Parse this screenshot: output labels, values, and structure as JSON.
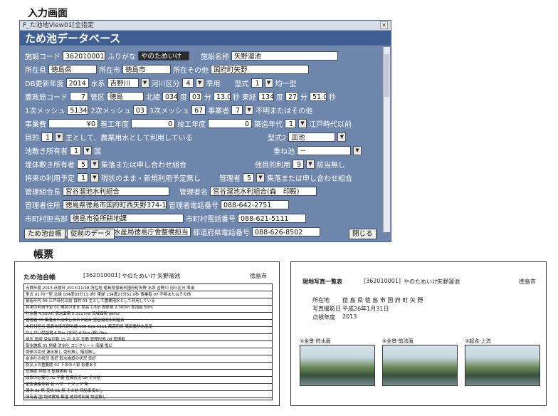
{
  "headings": {
    "input": "入力画面",
    "form": "帳票"
  },
  "window": {
    "title": "F_た池地View01[全指定",
    "form_title": "ため池データベース"
  },
  "fields": {
    "facility_code_label": "施設コード",
    "facility_code": "362010001",
    "furigana_label": "ふりがな",
    "furigana": "やのためいけ",
    "facility_name_label": "施設名称",
    "facility_name": "矢野溜池",
    "pref_label": "所在県",
    "pref": "徳島県",
    "city_label": "所在市",
    "city": "徳島市",
    "other_label": "所在その他",
    "other": "国府町矢野",
    "db_year_label": "DB更新年度",
    "db_year": "2014",
    "water_label": "水系",
    "water": "吉野川",
    "river_label": "河川区分",
    "river_num": "4",
    "river_val": "準用",
    "type_label": "型式",
    "type_num": "1",
    "type_val": "均一型",
    "agri_label": "農政局コード",
    "agri": "7",
    "district_label": "管区",
    "district": "徳島",
    "lat_label": "北緯",
    "lat_deg": "034",
    "deg1": "度",
    "lat_min": "03",
    "min1": "分",
    "lat_sec": "13.0",
    "sec1": "秒",
    "lon_label": "東経",
    "lon_deg": "134",
    "deg2": "度",
    "lon_min": "27",
    "min2": "分",
    "lon_sec": "51.0",
    "sec2": "秒",
    "mesh1_label": "1次メッシュ",
    "mesh1": "5134",
    "mesh2_label": "2次メッシュ",
    "mesh2": "03",
    "mesh3_label": "3次メッシュ",
    "mesh3": "67",
    "proj_label": "事業者",
    "proj_num": "7",
    "proj_val": "不明またはその他",
    "cost_label": "事業費",
    "cost": "¥0",
    "start_label": "着工年度",
    "start": "0",
    "done_label": "竣工年度",
    "done": "0",
    "era_label": "築造年代",
    "era_num": "1",
    "era_val": "江戸時代以前",
    "purpose_label": "目的",
    "purpose_num": "1",
    "purpose_val": "主として、農業用水として利用している",
    "type2_label": "型式2",
    "type2": "皿池",
    "ike_label": "池敷き所有者",
    "ike_num": "1",
    "ike_val": "国",
    "kasane_label": "重ね池",
    "kasane": "－",
    "tei_label": "堤体敷き所有者",
    "tei_num": "5",
    "tei_val": "集落または申し合わせ組合",
    "use_label": "他目的利用",
    "use_num": "9",
    "use_val": "該当無し",
    "future_label": "将来の利用予定",
    "future_num": "1",
    "future_val": "現状のまま・新規利用予定無し",
    "mgr_label": "管理者",
    "mgr_num": "5",
    "mgr_val": "集落または申し合わせ組合",
    "union_label": "管理組合長",
    "union": "宮谷溜池水利組合",
    "mgrname_label": "管理者名",
    "mgrname": "宮谷溜池水利組合(森　印殿)",
    "addr_label": "管理者住所",
    "addr": "徳島県徳島市国府町西矢野374-1",
    "tel_label": "管理者電話番号",
    "tel": "088-642-2751",
    "cityoff_label": "市町村担当部",
    "cityoff": "徳島市役所耕地課",
    "citytel_label": "市町村電話番号",
    "citytel": "088-621-5111",
    "prefoff_label": "都道府県担当部署",
    "prefoff": "東部農林水産局徳島庁舎整備担当",
    "preftel_label": "都道府県電話番号",
    "preftel": "088-626-8502"
  },
  "buttons": {
    "list": "ため池台帳",
    "prev": "従前のデータ",
    "close": "閉じる"
  },
  "ledger": {
    "title": "ため池台帳",
    "code": "[362010001]",
    "furigana": "やのためいけ",
    "name": "矢野溜池",
    "pref": "徳島市",
    "rows": [
      "点検年度 2013 点検日 2013/11/18 所在地 徳島県徳島市国府町矢野 水系 吉野川 河川区分 準用",
      "型式 01 均一型 北緯 034度03分13.0秒 東経 134度27分51.0秒 事業者 07 不明またはその他",
      "築造年代 09 江戸時代以前 目的 01 主として農業用水として利用している",
      "将来の利用予定 01 現状のまま 堤高 1.6m 堤体積 2,300㎥ 堤頂長 50m",
      "貯水量 4,500㎥ 満水面積 0.3317ha 流域面積 0km2",
      "管理者 05 集落または申し合わせ組合 宮谷溜池水利組合",
      "市町村担当 徳島市役所耕地課 088-621-5111 都道府県 東部農林水産局",
      "かんがい受益地 4.5ha (水田) 4.5ha (畑) 0ha",
      "地区 国府 受益戸数 15 戸 大字 矢野 管理形態 08 管理者",
      "取水施設 01 斜樋 洪水吐 コンクリート 底樋 塩ビ",
      "堤体の状況 漏水無し 変形無し 陥没無し",
      "余水吐の状況 良好 取水施設の状況 良好",
      "防災上の重要度 02 下流の人家 影響あり",
      "危険度 評価 B 監視体制 有",
      "改修の必要性 01 不要 整備状況 08 その他",
      "緊急連絡体制 有 ハザードマップ 無",
      "漏水 01 無 変状 01 無 その他 特記事項なし",
      "所有者 国 堤体敷地 集落 他目的利用 該当無し"
    ]
  },
  "photo": {
    "title": "現地写真一覧表",
    "code": "[362010001]",
    "furigana": "やのためいけ",
    "name": "矢野溜池",
    "pref": "徳島市",
    "loc_label": "所在地",
    "loc": "徳 島 県 徳 島 市 国 府 町 矢 野",
    "date_label": "写真撮影日",
    "date": "平成26年1月31日",
    "year_label": "点検年度",
    "year": "2013",
    "captions": [
      "①全景-貯水面",
      "②全景-前法面",
      "③起点-上流"
    ]
  }
}
